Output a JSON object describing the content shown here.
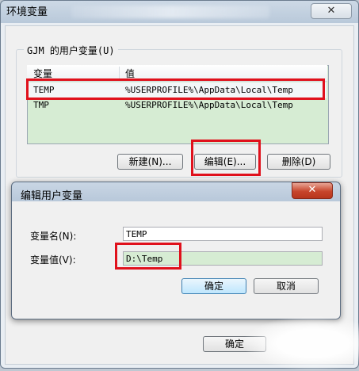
{
  "window": {
    "title": "环境变量",
    "close_label": "✕"
  },
  "user_vars": {
    "group_label": "GJM 的用户变量(U)",
    "columns": [
      "变量",
      "值"
    ],
    "rows": [
      {
        "name": "TEMP",
        "value": "%USERPROFILE%\\AppData\\Local\\Temp"
      },
      {
        "name": "TMP",
        "value": "%USERPROFILE%\\AppData\\Local\\Temp"
      }
    ],
    "buttons": {
      "new": "新建(N)...",
      "edit": "编辑(E)...",
      "delete": "删除(D)"
    }
  },
  "dialog": {
    "title": "编辑用户变量",
    "close_label": "✕",
    "name_label": "变量名(N):",
    "name_value": "TEMP",
    "value_label": "变量值(V):",
    "value_value": "D:\\Temp",
    "ok": "确定",
    "cancel": "取消"
  },
  "footer": {
    "ok": "确定"
  },
  "colors": {
    "highlight": "#e0111c",
    "list_bg": "#d6ecd3",
    "focus": "#3c7fb1"
  }
}
